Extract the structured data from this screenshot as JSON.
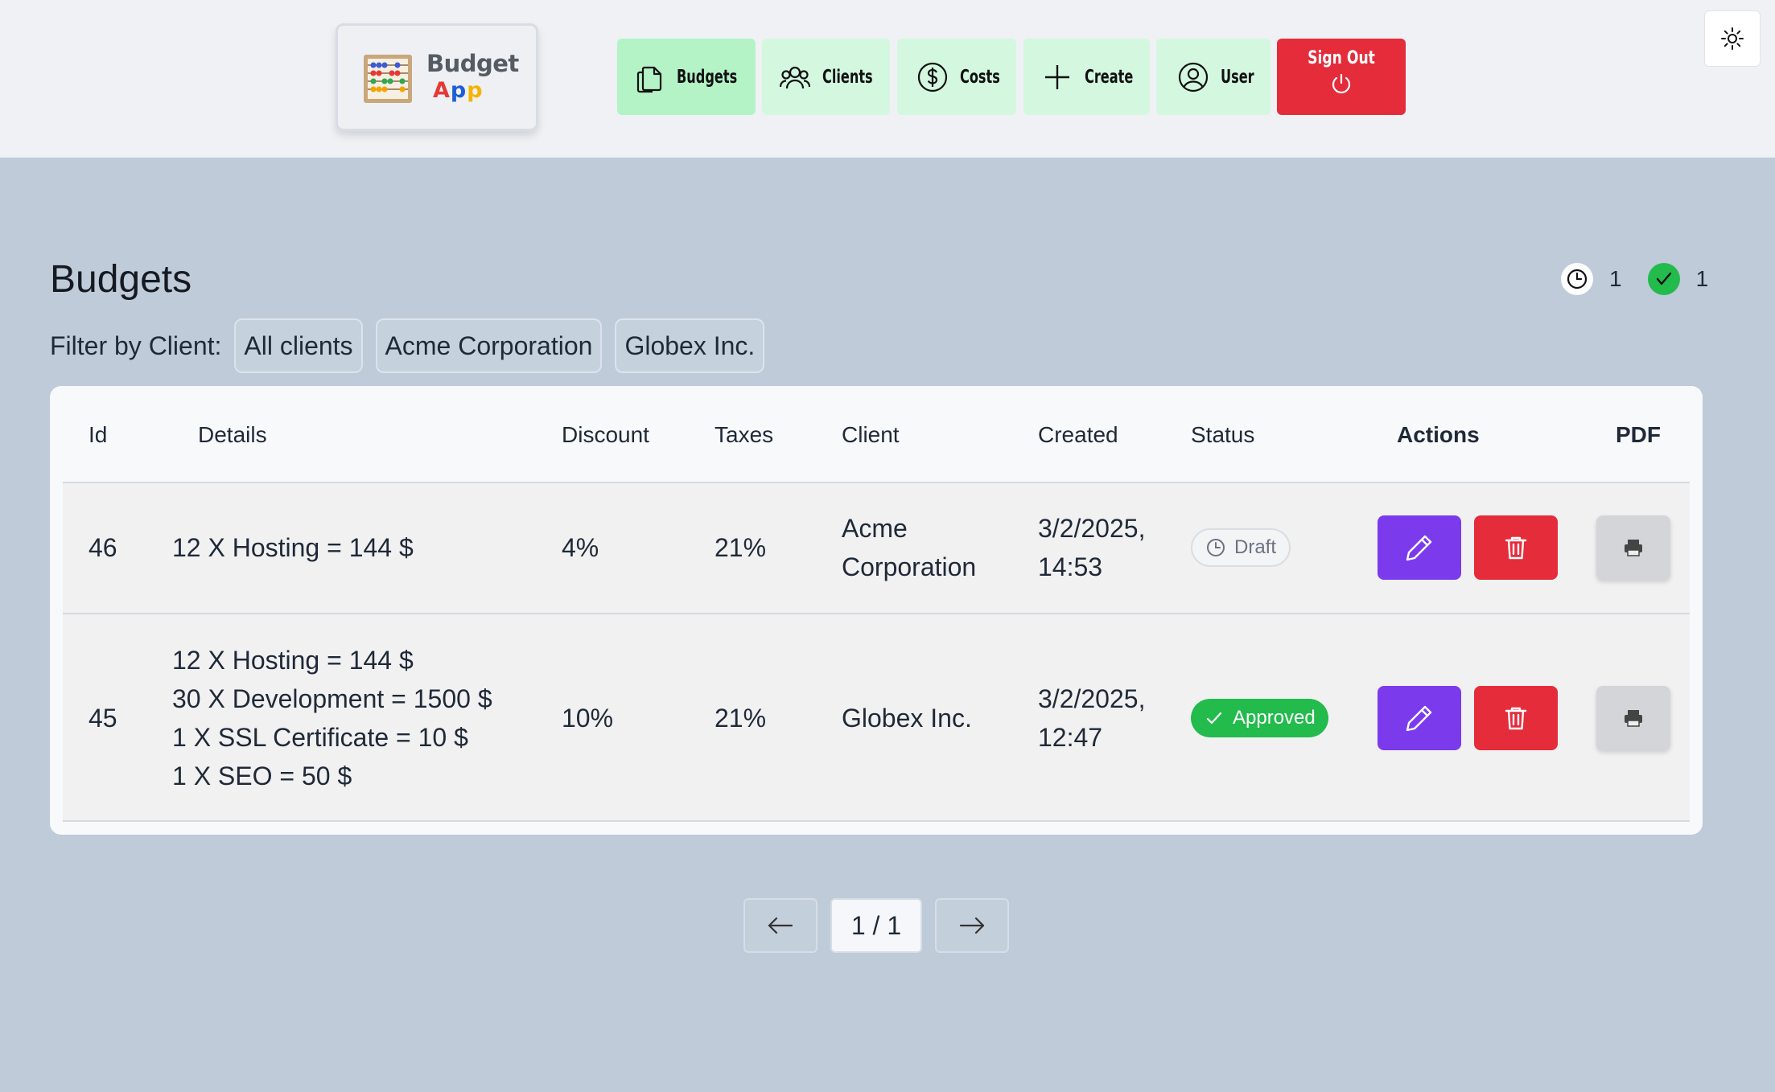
{
  "app": {
    "logo_word1": "Budget",
    "logo_word2": [
      "A",
      "p",
      "p"
    ]
  },
  "nav": {
    "budgets": "Budgets",
    "clients": "Clients",
    "costs": "Costs",
    "create": "Create",
    "user": "User",
    "sign_out": "Sign Out"
  },
  "page": {
    "title": "Budgets",
    "pending_count": "1",
    "approved_count": "1",
    "filter_label": "Filter by Client:",
    "filters": [
      "All clients",
      "Acme Corporation",
      "Globex Inc."
    ]
  },
  "table": {
    "headers": {
      "id": "Id",
      "details": "Details",
      "discount": "Discount",
      "taxes": "Taxes",
      "client": "Client",
      "created": "Created",
      "status": "Status",
      "actions": "Actions",
      "pdf": "PDF"
    },
    "rows": [
      {
        "id": "46",
        "details": [
          "12 X Hosting = 144 $"
        ],
        "discount": "4%",
        "taxes": "21%",
        "client": [
          "Acme",
          "Corporation"
        ],
        "created": [
          "3/2/2025,",
          "14:53"
        ],
        "status": "Draft"
      },
      {
        "id": "45",
        "details": [
          "12 X Hosting = 144 $",
          "30 X Development = 1500 $",
          "1 X SSL Certificate = 10 $",
          "1 X SEO = 50 $"
        ],
        "discount": "10%",
        "taxes": "21%",
        "client": [
          "Globex Inc."
        ],
        "created": [
          "3/2/2025,",
          "12:47"
        ],
        "status": "Approved"
      }
    ]
  },
  "pagination": {
    "label": "1 / 1"
  },
  "colors": {
    "nav_bg": "#d3f8df",
    "nav_active": "#b4f3c6",
    "danger": "#e42c3a",
    "edit": "#7c3aed",
    "approved": "#22bb4c",
    "page_bg": "#bfcbd9"
  }
}
